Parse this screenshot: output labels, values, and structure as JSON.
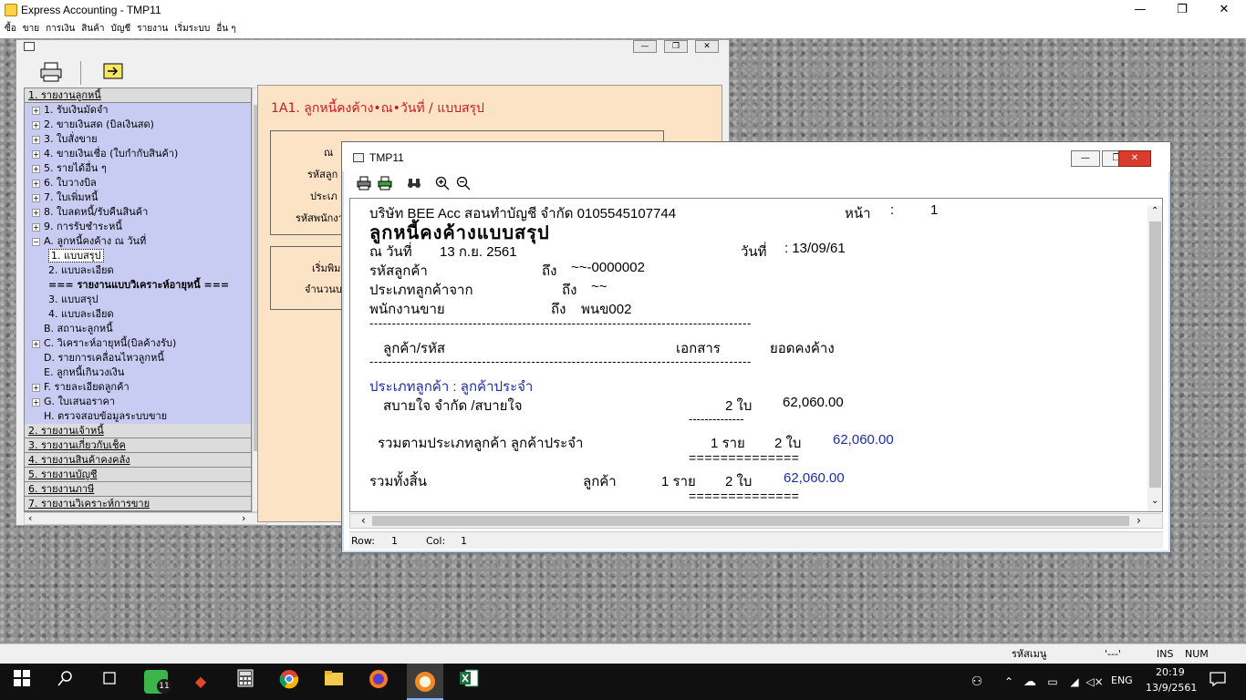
{
  "app": {
    "title": "Express Accounting - TMP11"
  },
  "window_controls": {
    "minimize": "—",
    "maximize": "❐",
    "close": "✕"
  },
  "menu": [
    "ซื้อ",
    "ขาย",
    "การเงิน",
    "สินค้า",
    "บัญชี",
    "รายงาน",
    "เริ่มระบบ",
    "อื่น ๆ"
  ],
  "tree": [
    {
      "label": "1. รายงานลูกหนี้",
      "level": 0,
      "expander": "",
      "style": "hdr"
    },
    {
      "label": "1. รับเงินมัดจำ",
      "level": 1,
      "expander": "+",
      "style": "sel"
    },
    {
      "label": "2. ขายเงินสด (บิลเงินสด)",
      "level": 1,
      "expander": "+",
      "style": "sel"
    },
    {
      "label": "3. ใบสั่งขาย",
      "level": 1,
      "expander": "+",
      "style": "sel"
    },
    {
      "label": "4. ขายเงินเชื่อ (ใบกำกับสินค้า)",
      "level": 1,
      "expander": "+",
      "style": "sel"
    },
    {
      "label": "5. รายได้อื่น ๆ",
      "level": 1,
      "expander": "+",
      "style": "sel"
    },
    {
      "label": "6. ใบวางบิล",
      "level": 1,
      "expander": "+",
      "style": "sel"
    },
    {
      "label": "7. ใบเพิ่มหนี้",
      "level": 1,
      "expander": "+",
      "style": "sel"
    },
    {
      "label": "8. ใบลดหนี้/รับคืนสินค้า",
      "level": 1,
      "expander": "+",
      "style": "sel"
    },
    {
      "label": "9. การรับชำระหนี้",
      "level": 1,
      "expander": "+",
      "style": "sel"
    },
    {
      "label": "A. ลูกหนี้คงค้าง ณ วันที่",
      "level": 1,
      "expander": "−",
      "style": "sel"
    },
    {
      "label": "1. แบบสรุป",
      "level": 2,
      "expander": "",
      "style": "cur"
    },
    {
      "label": "2. แบบละเอียด",
      "level": 2,
      "expander": "",
      "style": "sel"
    },
    {
      "label": "=== รายงานแบบวิเคราะห์อายุหนี้ ===",
      "level": 2,
      "expander": "",
      "style": "selb"
    },
    {
      "label": "3. แบบสรุป",
      "level": 2,
      "expander": "",
      "style": "sel"
    },
    {
      "label": "4. แบบละเอียด",
      "level": 2,
      "expander": "",
      "style": "sel"
    },
    {
      "label": "B. สถานะลูกหนี้",
      "level": 1,
      "expander": "",
      "style": "sel"
    },
    {
      "label": "C. วิเคราะห์อายุหนี้(บิลค้างรับ)",
      "level": 1,
      "expander": "+",
      "style": "sel"
    },
    {
      "label": "D. รายการเคลื่อนไหวลูกหนี้",
      "level": 1,
      "expander": "",
      "style": "sel"
    },
    {
      "label": "E. ลูกหนี้เกินวงเงิน",
      "level": 1,
      "expander": "",
      "style": "sel"
    },
    {
      "label": "F. รายละเอียดลูกค้า",
      "level": 1,
      "expander": "+",
      "style": "sel"
    },
    {
      "label": "G. ใบเสนอราคา",
      "level": 1,
      "expander": "+",
      "style": "sel"
    },
    {
      "label": "H. ตรวจสอบข้อมูลระบบขาย",
      "level": 1,
      "expander": "",
      "style": "sel"
    },
    {
      "label": "2. รายงานเจ้าหนี้",
      "level": 0,
      "expander": "",
      "style": "hdr"
    },
    {
      "label": "3. รายงานเกี่ยวกับเช็ค",
      "level": 0,
      "expander": "",
      "style": "hdr"
    },
    {
      "label": "4. รายงานสินค้าคงคลัง",
      "level": 0,
      "expander": "",
      "style": "hdr"
    },
    {
      "label": "5. รายงานบัญชี",
      "level": 0,
      "expander": "",
      "style": "hdr"
    },
    {
      "label": "6. รายงานภาษี",
      "level": 0,
      "expander": "",
      "style": "hdr"
    },
    {
      "label": "7. รายงานวิเคราะห์การขาย",
      "level": 0,
      "expander": "",
      "style": "hdr"
    }
  ],
  "panel": {
    "title": "1A1. ลูกหนี้คงค้าง•ณ•วันที่ / แบบสรุป",
    "labels": [
      "ณ",
      "รหัสลูก",
      "ประเภ",
      "รหัสพนักงา",
      "เริ่มพิม",
      "จำนวนบ"
    ]
  },
  "report_window": {
    "title": "TMP11",
    "status": {
      "row_label": "Row:",
      "row": "1",
      "col_label": "Col:",
      "col": "1"
    }
  },
  "report": {
    "company": "บริษัท BEE Acc   สอนทำบัญชี  จำกัด 0105545107744",
    "page_label": "หน้า",
    "page_colon": ":",
    "page_no": "1",
    "heading": "ลูกหนี้คงค้างแบบสรุป",
    "as_of_label": "ณ วันที่",
    "as_of": "13 ก.ย. 2561",
    "print_date_label": "วันที่",
    "print_date": ": 13/09/61",
    "cust_label": "รหัสลูกค้า",
    "cust_to": "ถึง",
    "cust_range": "~~-0000002",
    "type_label": "ประเภทลูกค้าจาก",
    "type_to": "ถึง",
    "type_range": "~~",
    "sales_label": "พนักงานขาย",
    "sales_to": "ถึง",
    "sales_range": "พนข002",
    "dashes": "-------------------------------------------------------------------------------------",
    "col_customer": "ลูกค้า/รหัส",
    "col_docs": "เอกสาร",
    "col_balance": "ยอดคงค้าง",
    "group_label": "ประเภทลูกค้า   : ลูกค้าประจำ",
    "row_customer": "สบายใจ จำกัด /สบายใจ",
    "row_docs": "2 ใบ",
    "row_amount": "62,060.00",
    "sub_dash": "--------------",
    "sub_label": "รวมตามประเภทลูกค้า   ลูกค้าประจำ",
    "sub_count": "1 ราย",
    "sub_docs": "2 ใบ",
    "sub_amount": "62,060.00",
    "eq": "==============",
    "total_label": "รวมทั้งสิ้น",
    "total_cust": "ลูกค้า",
    "total_count": "1 ราย",
    "total_docs": "2 ใบ",
    "total_amount": "62,060.00",
    "eq2": "=============="
  },
  "statusbar": {
    "menu_code_label": "รหัสเมนู",
    "menu_code": "'---'",
    "ins": "INS",
    "num": "NUM"
  },
  "taskbar": {
    "badge": "11",
    "lang": "ENG",
    "time": "20:19",
    "date": "13/9/2561"
  }
}
